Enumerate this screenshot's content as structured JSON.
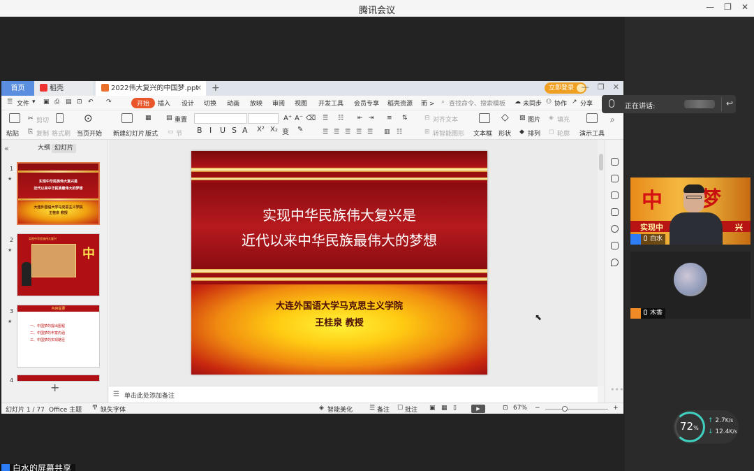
{
  "meeting": {
    "app_title": "腾讯会议",
    "speaking_label": "正在讲话:",
    "share_label": "白水的屏幕共享",
    "participants": [
      {
        "name": "白水"
      },
      {
        "name": "木香"
      }
    ],
    "network": {
      "cpu": "72",
      "unit": "%",
      "up": "2.7",
      "down": "12.4",
      "rate_unit": "K/s"
    }
  },
  "wps": {
    "tabs": {
      "home": "首页",
      "docer": "稻壳",
      "doc": "2022伟大复兴的中国梦.ppt"
    },
    "login": "立即登录",
    "menu": {
      "file": "文件"
    },
    "ribbon_tabs": [
      "开始",
      "插入",
      "设计",
      "切换",
      "动画",
      "放映",
      "审阅",
      "视图",
      "开发工具",
      "会员专享",
      "稻壳资源",
      "而 >"
    ],
    "ribbon_search": "查找命令、搜索模板",
    "ribbon_right": {
      "sync": "未同步",
      "collab": "协作",
      "share": "分享"
    },
    "toolbar": {
      "paste": "粘贴",
      "cut": "剪切",
      "copy": "复制",
      "format_painter": "格式刷",
      "from_current": "当页开始",
      "new_slide": "新建幻灯片",
      "layout": "版式",
      "section": "节",
      "reset": "重置",
      "align_text": "对齐文本",
      "to_smartart": "转智能图形",
      "textbox": "文本框",
      "shape": "形状",
      "picture": "图片",
      "fill": "填充",
      "arrange": "排列",
      "outline": "轮廓",
      "presenter": "演示工具"
    },
    "panel_tabs": {
      "outline": "大纲",
      "slides": "幻灯片"
    },
    "thumbnails": [
      {
        "num": "1",
        "line1": "实现中华民族伟大复兴是",
        "line2": "近代以来中华民族最伟大的梦想",
        "line3": "大连外国语大学马克思主义学院",
        "line4": "王桂泉 教授"
      },
      {
        "num": "2",
        "title": "实现中华民族伟大复兴",
        "big": "中"
      },
      {
        "num": "3",
        "title": "内容提要",
        "items": [
          "一、中国梦的提出图程",
          "二、中国梦的丰富内涵",
          "三、中国梦的实现路径"
        ]
      },
      {
        "num": "4"
      }
    ],
    "slide": {
      "title1": "实现中华民族伟大复兴是",
      "title2": "近代以来中华民族最伟大的梦想",
      "org": "大连外国语大学马克思主义学院",
      "author": "王桂泉  教授"
    },
    "notes_placeholder": "单击此处添加备注",
    "status": {
      "slide_count": "幻灯片 1 / 77",
      "theme": "Office 主题",
      "missing_font": "缺失字体",
      "beautify": "智能美化",
      "notes": "备注",
      "comments": "批注",
      "zoom": "67%"
    }
  }
}
